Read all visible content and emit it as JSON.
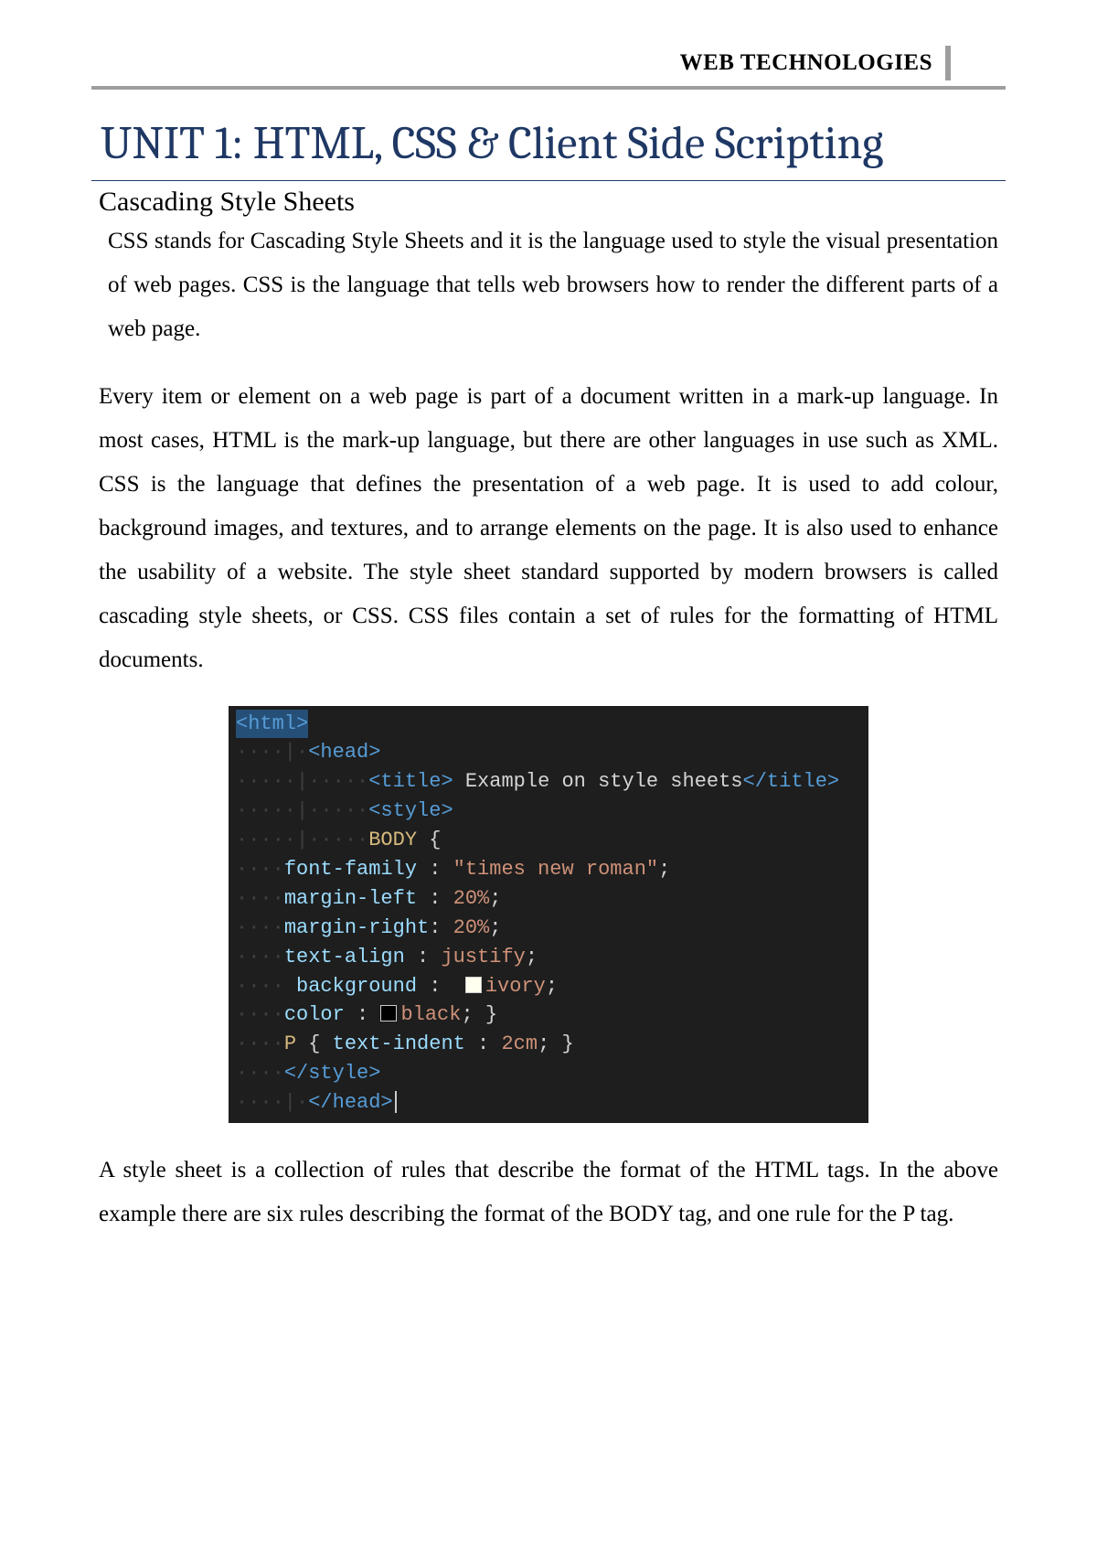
{
  "header": {
    "course": "WEB TECHNOLOGIES"
  },
  "title": "UNIT 1: HTML, CSS & Client Side Scripting",
  "subtitle": "Cascading Style Sheets",
  "paragraphs": {
    "p1": "CSS stands for Cascading Style Sheets and it is the language used to style the visual presentation of web pages. CSS is the language that tells web browsers how to render the different parts of a web page.",
    "p2": "Every item or element on a web page is part of a document written in a mark-up language. In most cases, HTML is the mark-up language, but there are other languages in use such as XML. CSS is the language that defines the presentation of a web page. It is used to add colour, background images, and textures, and to arrange elements on the page. It is also used to enhance the usability of a website. The style sheet standard supported by modern browsers is called cascading style sheets, or CSS. CSS files contain a set of rules for the formatting of HTML documents.",
    "p3": "A style sheet is a collection of rules that describe the format of the HTML tags. In the above example there are six rules describing the format of the BODY tag, and one rule for the P tag."
  },
  "code": {
    "l1": {
      "open": "<html>"
    },
    "l2": {
      "dots": "····|·",
      "open": "<head>"
    },
    "l3": {
      "dots": "·····|·····",
      "open": "<title>",
      "text": " Example on style sheets",
      "close": "</title>"
    },
    "l4": {
      "dots": "·····|·····",
      "open": "<style>"
    },
    "l5": {
      "dots": "·····|·····",
      "sel": "BODY",
      "brace": " {"
    },
    "l6": {
      "dots": "····",
      "prop": "font-family",
      "sep": " : ",
      "val": "\"times new roman\"",
      "end": ";"
    },
    "l7": {
      "dots": "····",
      "prop": "margin-left",
      "sep": " : ",
      "val": "20%",
      "end": ";"
    },
    "l8": {
      "dots": "····",
      "prop": "margin-right",
      "sep": ": ",
      "val": "20%",
      "end": ";"
    },
    "l9": {
      "dots": "····",
      "prop": "text-align",
      "sep": " : ",
      "val": "justify",
      "end": ";"
    },
    "l10": {
      "dots": "····",
      "prop": " background",
      "sep": " :  ",
      "val": "ivory",
      "end": ";",
      "swatch": "#FFFFF0"
    },
    "l11": {
      "dots": "····",
      "prop": "color",
      "sep": " : ",
      "val": "black",
      "end": "; }",
      "swatch": "#000000"
    },
    "l12": {
      "dots": "····",
      "sel": "P",
      "brace": " { ",
      "prop": "text-indent",
      "sep": " : ",
      "val": "2cm",
      "end": "; }"
    },
    "l13": {
      "dots": "····",
      "close": "</style>"
    },
    "l14": {
      "dots": "····|·",
      "close": "</head>"
    }
  }
}
